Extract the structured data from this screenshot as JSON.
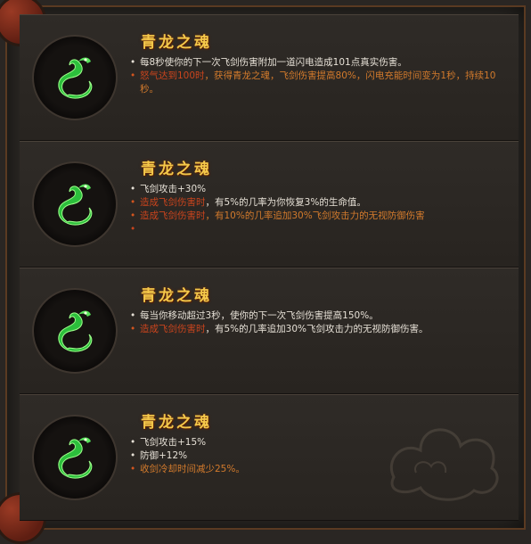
{
  "panels": [
    {
      "title": "青龙之魂",
      "lines": [
        {
          "type": "plain",
          "text": "每8秒使你的下一次飞剑伤害附加一道闪电造成101点真实伤害。"
        },
        {
          "type": "em",
          "highlight": "怒气达到100时",
          "rest": "，获得青龙之魂，飞剑伤害提高80%，闪电充能时间变为1秒，持续10秒。"
        }
      ]
    },
    {
      "title": "青龙之魂",
      "lines": [
        {
          "type": "plain",
          "text": "飞剑攻击+30%"
        },
        {
          "type": "em",
          "highlight": "造成飞剑伤害时",
          "rest": "，有5%的几率为你恢复3%的生命值。"
        },
        {
          "type": "em",
          "highlight": "造成飞剑伤害时",
          "rest": "，有10%的几率追加30%飞剑攻击力的无视防御伤害"
        },
        {
          "type": "bullet-only",
          "text": "•"
        }
      ]
    },
    {
      "title": "青龙之魂",
      "lines": [
        {
          "type": "plain",
          "text": "每当你移动超过3秒，使你的下一次飞剑伤害提高150%。"
        },
        {
          "type": "em",
          "highlight": "造成飞剑伤害时",
          "rest": "，有5%的几率追加30%飞剑攻击力的无视防御伤害。"
        }
      ]
    },
    {
      "title": "青龙之魂",
      "lines": [
        {
          "type": "plain",
          "text": "飞剑攻击+15%"
        },
        {
          "type": "plain",
          "text": "防御+12%"
        },
        {
          "type": "cooldown",
          "text": "收剑冷却时间减少25%。"
        }
      ]
    }
  ],
  "icons": {
    "badge": "jade-dragon-icon"
  },
  "colors": {
    "title": "#f4c84a",
    "highlight": "#c9441d",
    "text": "#e6e0d6",
    "jade": "#3fd04a"
  }
}
